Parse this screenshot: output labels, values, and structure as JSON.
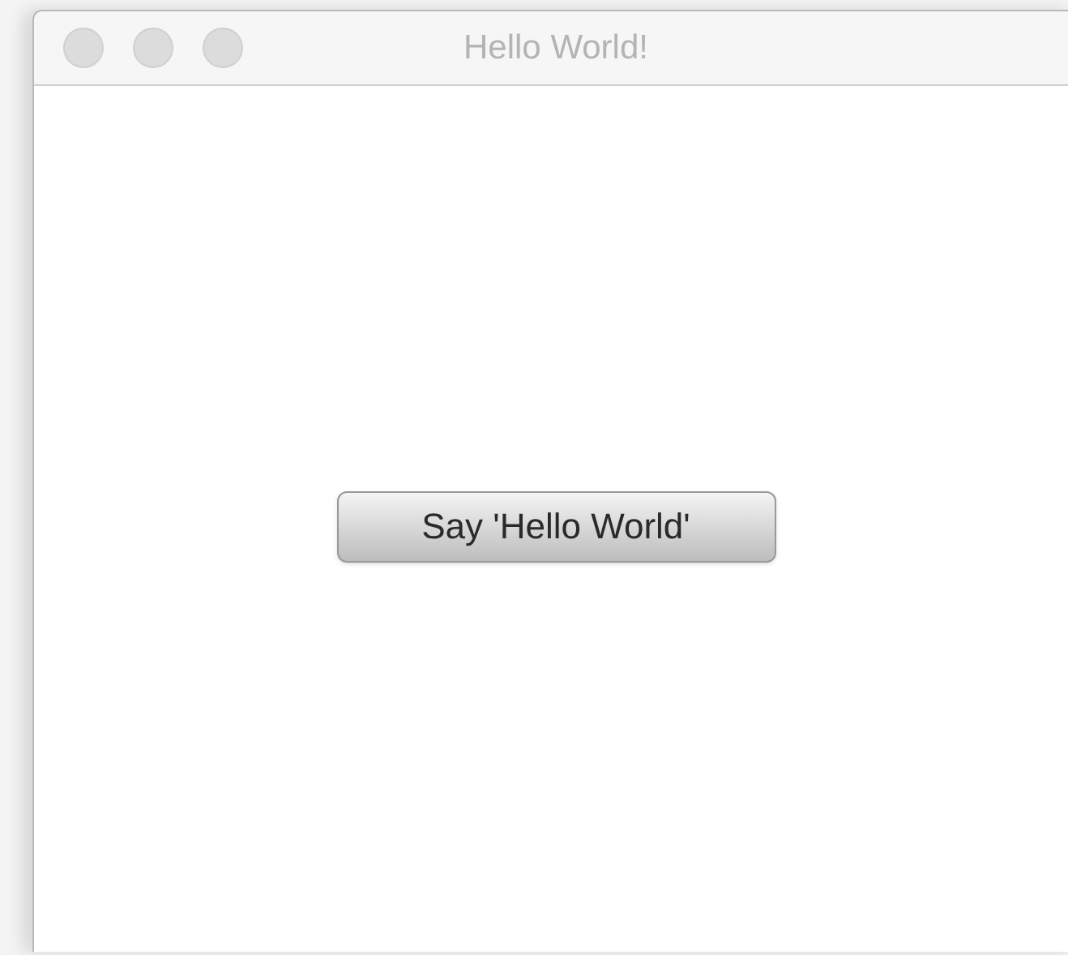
{
  "window": {
    "title": "Hello World!"
  },
  "button": {
    "label": "Say 'Hello World'"
  }
}
